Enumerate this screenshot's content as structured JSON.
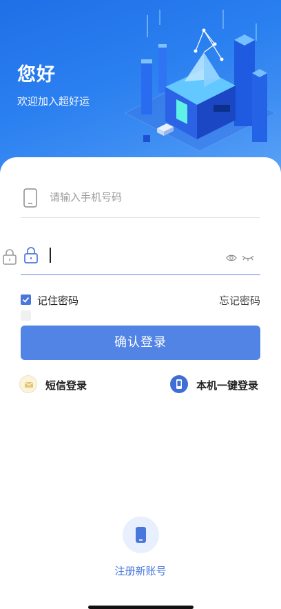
{
  "header": {
    "greeting": "您好",
    "subtitle": "欢迎加入超好运"
  },
  "login_form": {
    "phone_placeholder": "请输入手机号码",
    "password_value": "",
    "remember_label": "记住密码",
    "remember_checked": true,
    "forgot_label": "忘记密码",
    "submit_label": "确认登录"
  },
  "alt_login": {
    "sms_label": "短信登录",
    "onekey_label": "本机一键登录"
  },
  "register": {
    "label": "注册新账号"
  },
  "colors": {
    "primary": "#5284e6",
    "accent": "#4a77dc",
    "hero_start": "#1f6fe6",
    "hero_end": "#5aa2f6"
  },
  "icons": [
    "phone-icon",
    "lock-icon",
    "eye-icon",
    "eye-closed-icon",
    "envelope-icon",
    "mobile-icon"
  ]
}
